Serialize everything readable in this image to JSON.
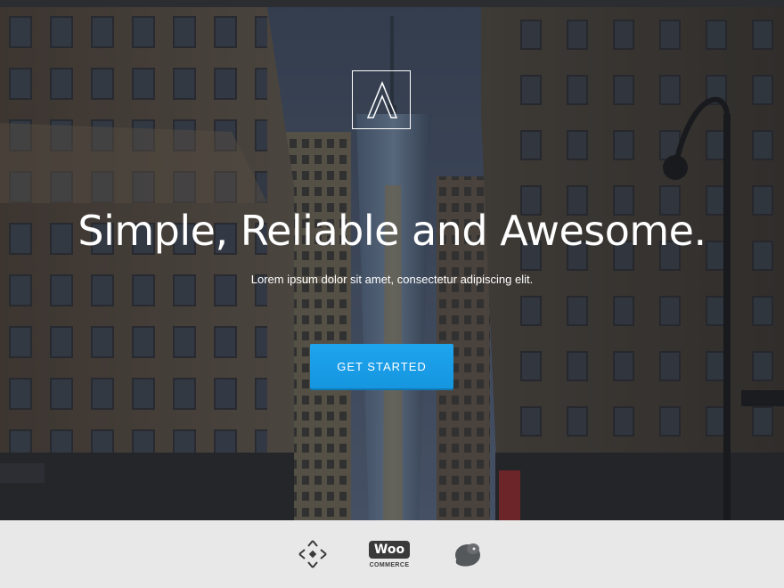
{
  "hero": {
    "background_image": "city-street-buildings",
    "logo_icon": "a-logo-icon",
    "title": "Simple, Reliable and Awesome.",
    "subtitle": "Lorem ipsum dolor sit amet, consectetur adipiscing elit.",
    "cta_label": "GET STARTED",
    "accent_color": "#1a9ae6"
  },
  "footer": {
    "partners": [
      {
        "name": "move-arrows-icon"
      },
      {
        "name": "woocommerce-logo",
        "text_top": "Woo",
        "text_bottom": "COMMERCE"
      },
      {
        "name": "mailchimp-logo"
      }
    ]
  }
}
